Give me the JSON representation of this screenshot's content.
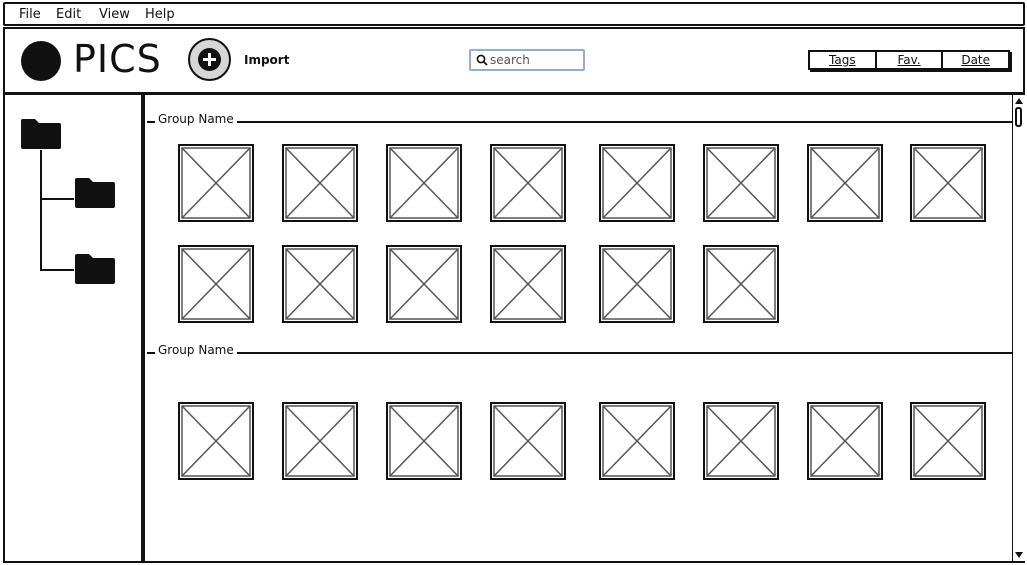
{
  "menu": {
    "file": "File",
    "edit": "Edit",
    "view": "View",
    "help": "Help"
  },
  "header": {
    "app_title": "PICS",
    "import_label": "Import",
    "search_placeholder": "search",
    "filters": [
      "Tags",
      "Fav.",
      "Date"
    ]
  },
  "sidebar": {
    "icons": [
      "folder-icon",
      "folder-icon",
      "folder-icon"
    ]
  },
  "groups": [
    {
      "name": "Group Name",
      "image_count": 14
    },
    {
      "name": "Group Name",
      "image_count": 8
    }
  ],
  "colors": {
    "ink": "#111111",
    "search_border": "#8fb0d6",
    "import_button": "#d6d6d6"
  }
}
